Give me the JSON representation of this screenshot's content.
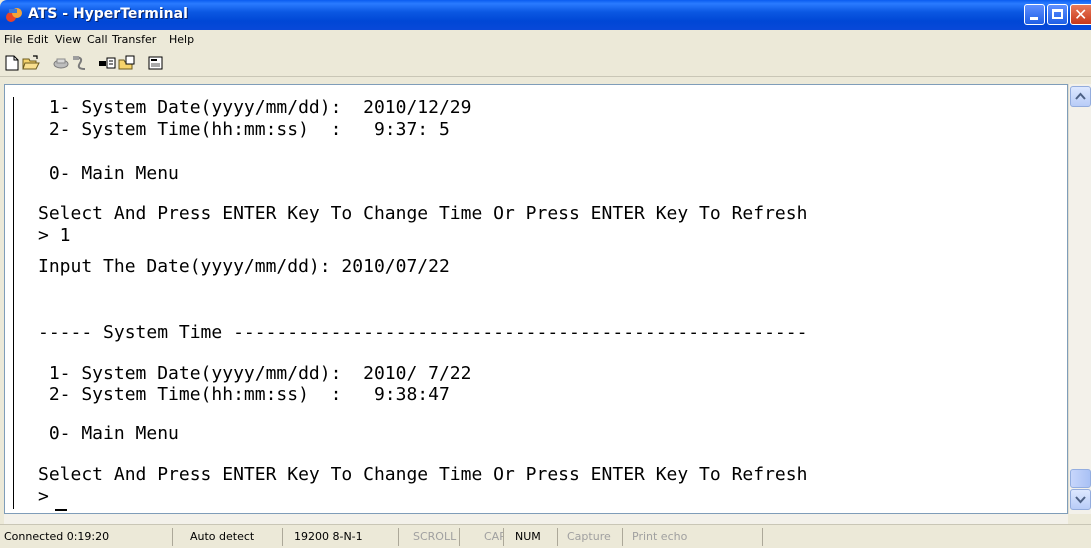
{
  "window": {
    "title": "ATS - HyperTerminal"
  },
  "menu": [
    "File",
    "Edit",
    "View",
    "Call",
    "Transfer",
    "Help"
  ],
  "toolbar": [
    "new-icon",
    "open-icon",
    "disconnect-icon",
    "dial-icon",
    "send-icon",
    "receive-icon",
    "properties-icon"
  ],
  "terminal": {
    "lines": [
      " 1- System Date(yyyy/mm/dd):  2010/12/29",
      " 2- System Time(hh:mm:ss)  :   9:37: 5",
      "",
      " 0- Main Menu",
      "",
      "Select And Press ENTER Key To Change Time Or Press ENTER Key To Refresh",
      "> 1",
      "",
      "Input The Date(yyyy/mm/dd): 2010/07/22",
      "",
      "",
      "----- System Time -----------------------------------------------------",
      "",
      " 1- System Date(yyyy/mm/dd):  2010/ 7/22",
      " 2- System Time(hh:mm:ss)  :   9:38:47",
      "",
      " 0- Main Menu",
      "",
      "Select And Press ENTER Key To Change Time Or Press ENTER Key To Refresh",
      "> "
    ]
  },
  "status": {
    "connected": "Connected 0:19:20",
    "detect": "Auto detect",
    "settings": "19200 8-N-1",
    "scroll": "SCROLL",
    "caps": "CAPS",
    "num": "NUM",
    "capture": "Capture",
    "print_echo": "Print echo"
  }
}
